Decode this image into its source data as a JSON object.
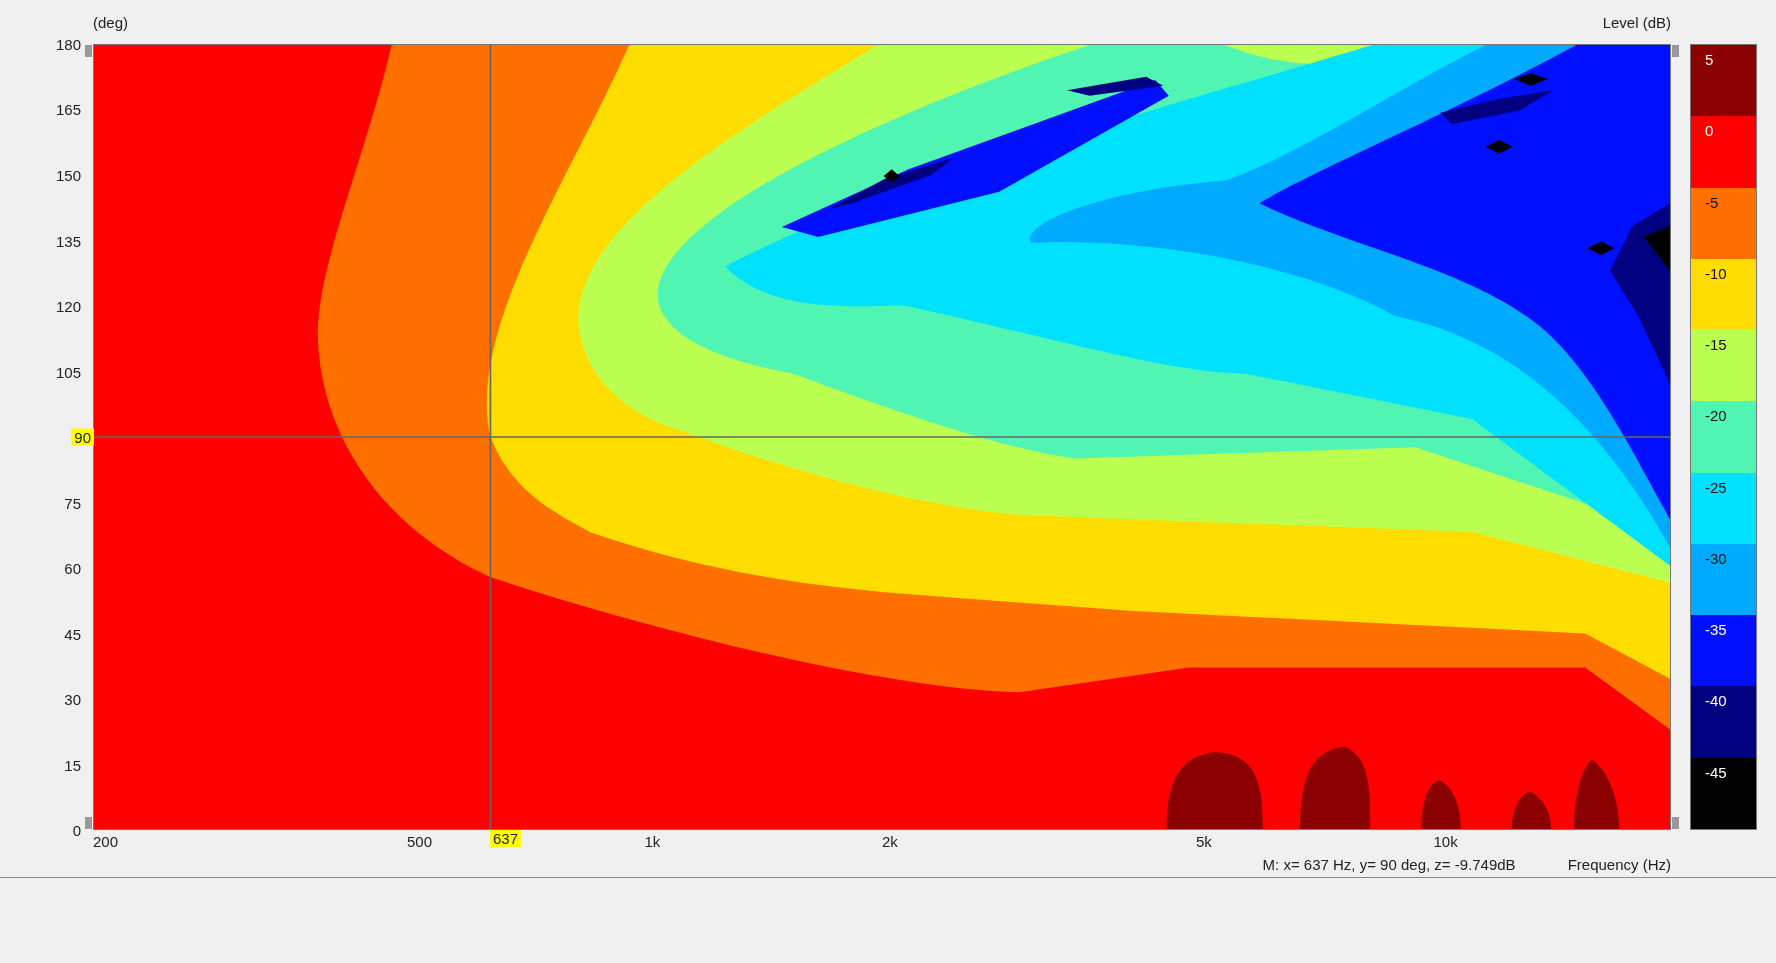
{
  "plot": {
    "y_unit": "(deg)",
    "z_unit": "Level  (dB)",
    "x_label": "Frequency  (Hz)",
    "readout": "M:  x= 637 Hz,  y= 90 deg, z= -9.749dB",
    "xticks": [
      "200",
      "500",
      "1k",
      "2k",
      "5k",
      "10k"
    ],
    "yticks": [
      "180",
      "165",
      "150",
      "135",
      "120",
      "105",
      "75",
      "60",
      "45",
      "30",
      "15",
      "0"
    ],
    "cursor": {
      "x_label": "637",
      "y_label": "90"
    }
  },
  "color_scale": [
    {
      "label": "5",
      "color": "#8b0000"
    },
    {
      "label": "0",
      "color": "#ff0000"
    },
    {
      "label": "-5",
      "color": "#ff7000"
    },
    {
      "label": "-10",
      "color": "#ffdd00"
    },
    {
      "label": "-15",
      "color": "#bbff50"
    },
    {
      "label": "-20",
      "color": "#50f5b4"
    },
    {
      "label": "-25",
      "color": "#00e0ff"
    },
    {
      "label": "-30",
      "color": "#00aaff"
    },
    {
      "label": "-35",
      "color": "#0010ff"
    },
    {
      "label": "-40",
      "color": "#000080"
    },
    {
      "label": "-45",
      "color": "#000000"
    }
  ]
}
